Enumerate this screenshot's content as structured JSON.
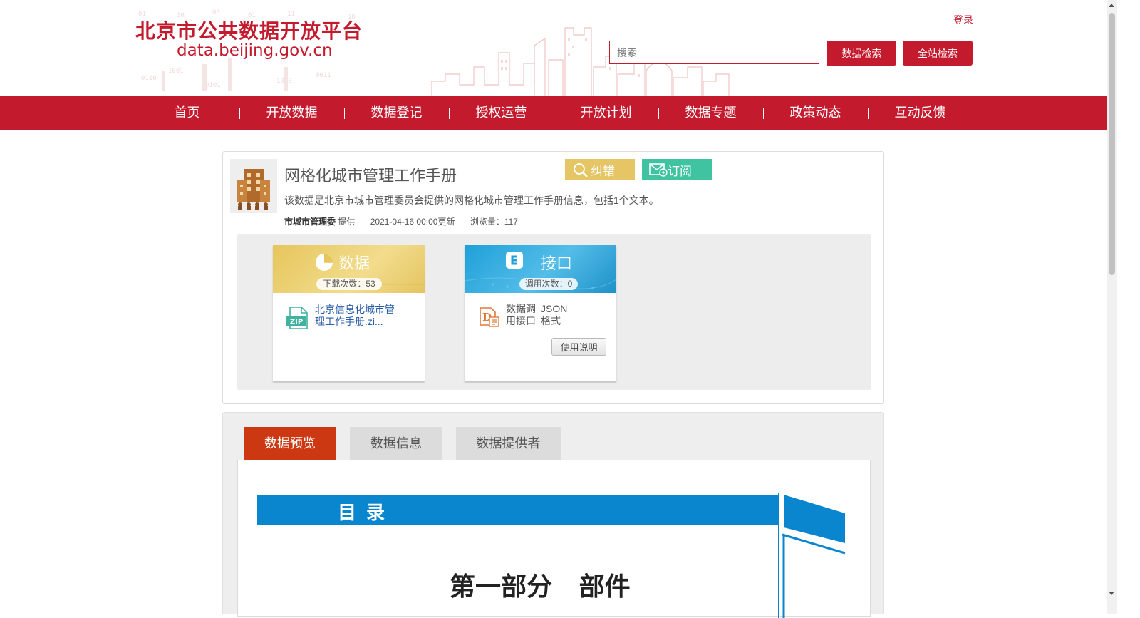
{
  "header": {
    "logo_title": "北京市公共数据开放平台",
    "logo_url": "data.beijing.gov.cn",
    "login_label": "登录",
    "search_placeholder": "搜索",
    "data_search_label": "数据检索",
    "site_search_label": "全站检索"
  },
  "nav": {
    "items": [
      {
        "label": "首页"
      },
      {
        "label": "开放数据"
      },
      {
        "label": "数据登记"
      },
      {
        "label": "授权运营"
      },
      {
        "label": "开放计划"
      },
      {
        "label": "数据专题"
      },
      {
        "label": "政策动态"
      },
      {
        "label": "互动反馈"
      }
    ]
  },
  "dataset": {
    "title": "网格化城市管理工作手册",
    "correct_label": "纠错",
    "subscribe_label": "订阅",
    "description": "该数据是北京市城市管理委员会提供的网格化城市管理工作手册信息，包括1个文本。",
    "provider": "市城市管理委",
    "provider_suffix": "提供",
    "updated": "2021-04-16 00:00更新",
    "views": "浏览量：117"
  },
  "resources": {
    "data": {
      "title": "数据",
      "count": "下载次数：53",
      "file_name": "北京信息化城市管理工作手册.zi...",
      "file_icon": "zip-file-icon"
    },
    "api": {
      "title": "接口",
      "count": "调用次数：0",
      "api_name": "数据调用接口",
      "api_format": "JSON格式",
      "usage_label": "使用说明",
      "api_icon": "document-api-icon"
    }
  },
  "tabs": {
    "items": [
      {
        "label": "数据预览",
        "active": true
      },
      {
        "label": "数据信息",
        "active": false
      },
      {
        "label": "数据提供者",
        "active": false
      }
    ]
  },
  "preview": {
    "toc_title": "目录",
    "part_heading": "第一部分   部件"
  },
  "colors": {
    "brand_red": "#c41a2e",
    "tab_active": "#cc3812",
    "correct_yellow": "#e5c564",
    "subscribe_green": "#3fc3a1",
    "toc_blue": "#0a86cf"
  }
}
